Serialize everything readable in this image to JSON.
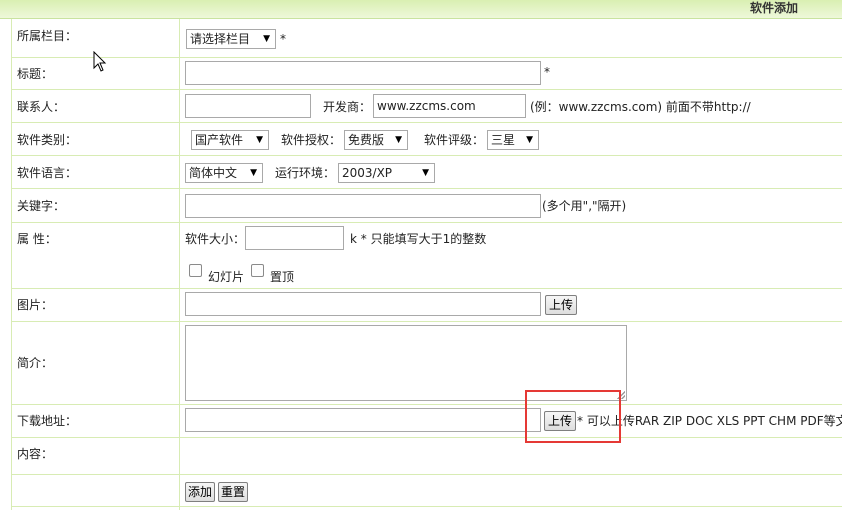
{
  "header": {
    "title": "软件添加"
  },
  "rows": {
    "category": {
      "label": "所属栏目：",
      "select": "请选择栏目",
      "required": "*"
    },
    "title": {
      "label": "标题：",
      "required": "*"
    },
    "contact": {
      "label": "联系人：",
      "developer_label": "开发商：",
      "developer_value": "www.zzcms.com",
      "hint": "(例：www.zzcms.com) 前面不带http://"
    },
    "type": {
      "label": "软件类别：",
      "type_select": "国产软件",
      "license_label": "软件授权：",
      "license_select": "免费版",
      "rating_label": "软件评级：",
      "rating_select": "三星"
    },
    "language": {
      "label": "软件语言：",
      "language_select": "简体中文",
      "env_label": "运行环境：",
      "env_select": "2003/XP"
    },
    "keywords": {
      "label": "关键字：",
      "hint": "(多个用\",\"隔开)"
    },
    "attributes": {
      "label": "属 性：",
      "size_label": "软件大小：",
      "size_hint": "k * 只能填写大于1的整数",
      "slideshow": "幻灯片",
      "pin_top": "置顶"
    },
    "image": {
      "label": "图片：",
      "upload": "上传"
    },
    "intro": {
      "label": "简介："
    },
    "download": {
      "label": "下载地址：",
      "upload": "上传",
      "hint": "* 可以上传RAR ZIP DOC XLS PPT CHM PDF等文"
    },
    "content": {
      "label": "内容："
    }
  },
  "actions": {
    "add": "添加",
    "reset": "重置"
  },
  "colors": {
    "accent_green": "#d9efb2",
    "grid_line": "#d8ecb4",
    "highlight": "#e53935"
  }
}
